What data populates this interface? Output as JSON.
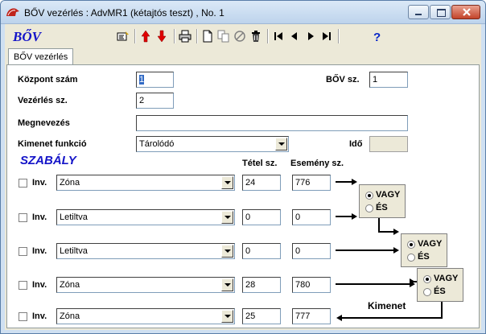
{
  "window": {
    "title": "BŐV vezérlés : AdvMR1 (kétajtós teszt) , No. 1"
  },
  "toolbar": {
    "brand": "BŐV",
    "icons": [
      "select-icon",
      "arrow-up-icon",
      "arrow-down-icon",
      "print-icon",
      "new-icon",
      "copy-icon",
      "cancel-icon",
      "delete-icon",
      "first-icon",
      "prev-icon",
      "next-icon",
      "last-icon",
      "help-icon"
    ]
  },
  "tabs": [
    {
      "label": "BŐV vezérlés"
    }
  ],
  "form": {
    "kozpont_label": "Központ szám",
    "kozpont_value": "1",
    "bov_label": "BŐV sz.",
    "bov_value": "1",
    "vezerles_label": "Vezérlés sz.",
    "vezerles_value": "2",
    "megnevezes_label": "Megnevezés",
    "megnevezes_value": "",
    "kimenet_label": "Kimenet funkció",
    "kimenet_value": "Tárolódó",
    "ido_label": "Idő",
    "ido_value": ""
  },
  "rules": {
    "title": "SZABÁLY",
    "col_tetel": "Tétel sz.",
    "col_esemeny": "Esemény sz.",
    "inv_label": "Inv.",
    "rows": [
      {
        "type": "Zóna",
        "tetel": "24",
        "esemeny": "776"
      },
      {
        "type": "Letiltva",
        "tetel": "0",
        "esemeny": "0"
      },
      {
        "type": "Letiltva",
        "tetel": "0",
        "esemeny": "0"
      },
      {
        "type": "Zóna",
        "tetel": "28",
        "esemeny": "780"
      },
      {
        "type": "Zóna",
        "tetel": "25",
        "esemeny": "777"
      }
    ],
    "logic": [
      {
        "or_label": "VAGY",
        "and_label": "ÉS",
        "selected": "VAGY"
      },
      {
        "or_label": "VAGY",
        "and_label": "ÉS",
        "selected": "VAGY"
      },
      {
        "or_label": "VAGY",
        "and_label": "ÉS",
        "selected": "VAGY"
      }
    ],
    "output_label": "Kimenet"
  }
}
